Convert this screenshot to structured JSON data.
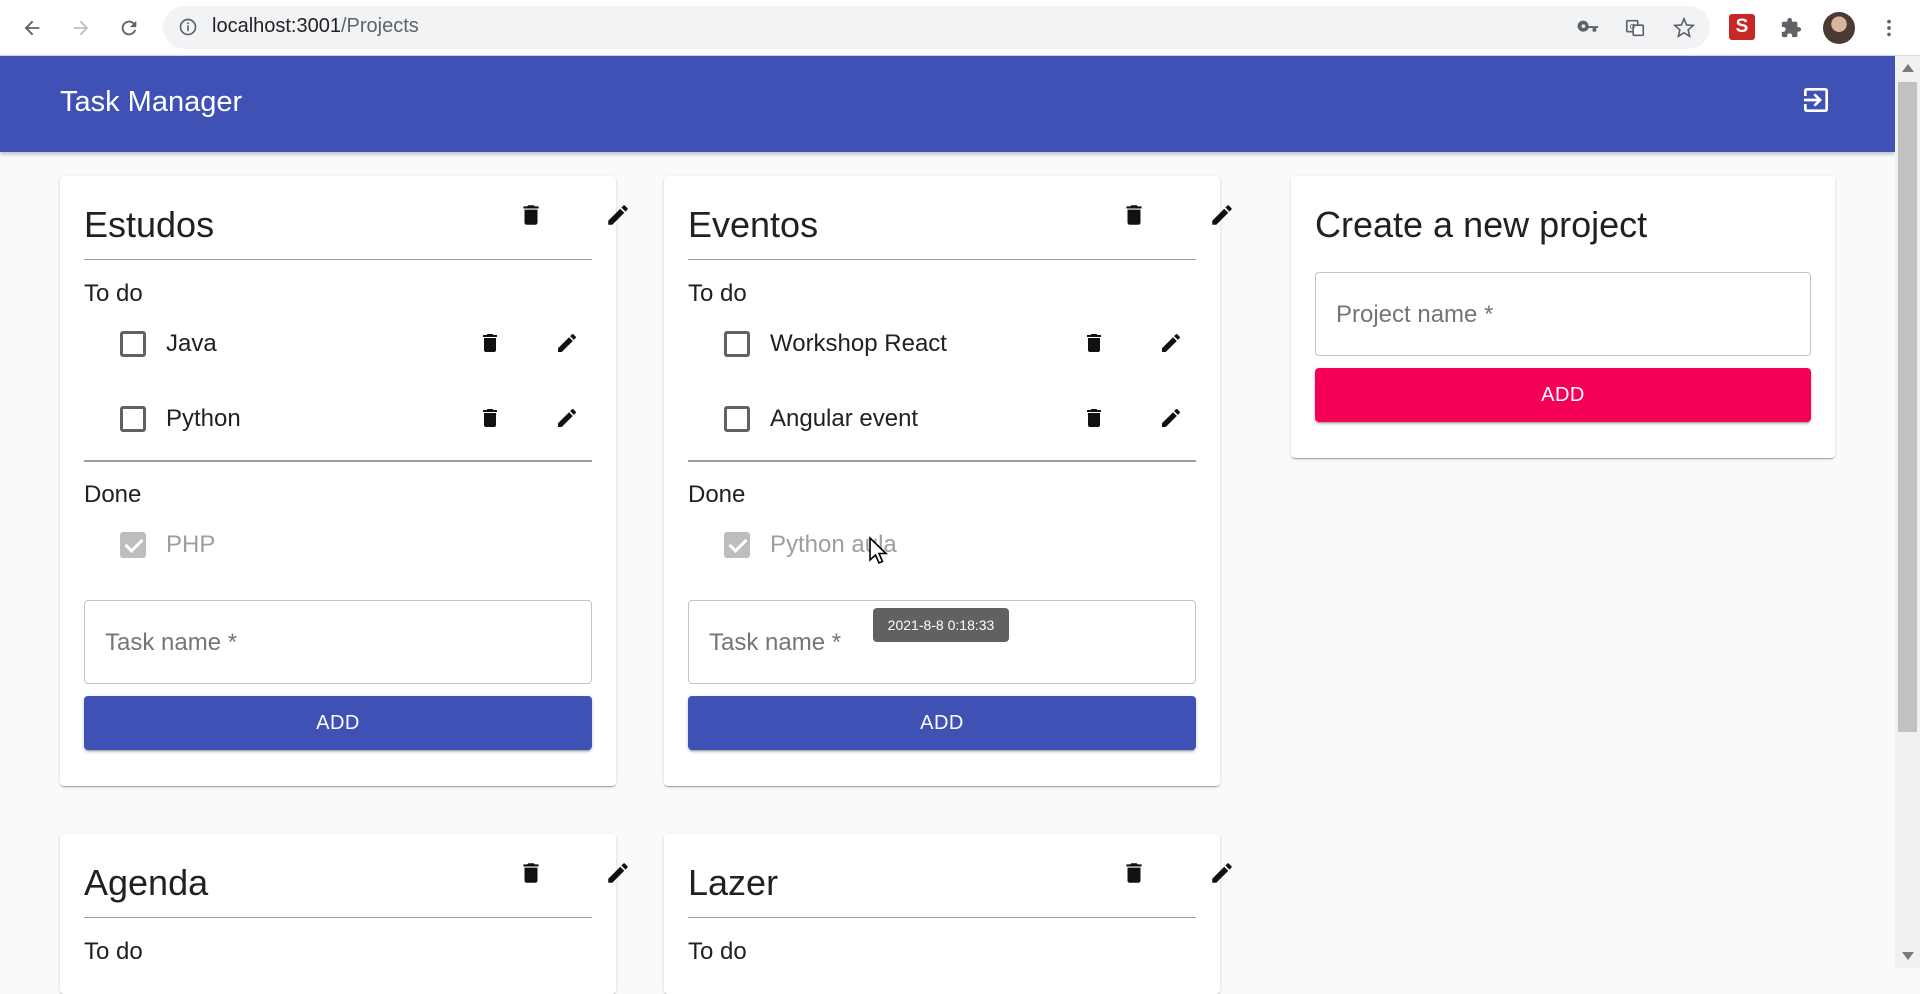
{
  "browser": {
    "url_host": "localhost:3001",
    "url_path": "/Projects"
  },
  "appbar": {
    "title": "Task Manager"
  },
  "projects": [
    {
      "title": "Estudos",
      "todo_label": "To do",
      "todo": [
        "Java",
        "Python"
      ],
      "done_label": "Done",
      "done": [
        "PHP"
      ],
      "task_placeholder": "Task name *",
      "add_label": "ADD"
    },
    {
      "title": "Eventos",
      "todo_label": "To do",
      "todo": [
        "Workshop React",
        "Angular event"
      ],
      "done_label": "Done",
      "done": [
        "Python aula"
      ],
      "task_placeholder": "Task name *",
      "add_label": "ADD"
    },
    {
      "title": "Agenda",
      "todo_label": "To do"
    },
    {
      "title": "Lazer",
      "todo_label": "To do"
    }
  ],
  "new_project": {
    "title": "Create a new project",
    "placeholder": "Project name *",
    "add_label": "ADD"
  },
  "tooltip": {
    "text": "2021-8-8 0:18:33"
  },
  "colors": {
    "primary": "#3f51b5",
    "secondary": "#f50057"
  }
}
